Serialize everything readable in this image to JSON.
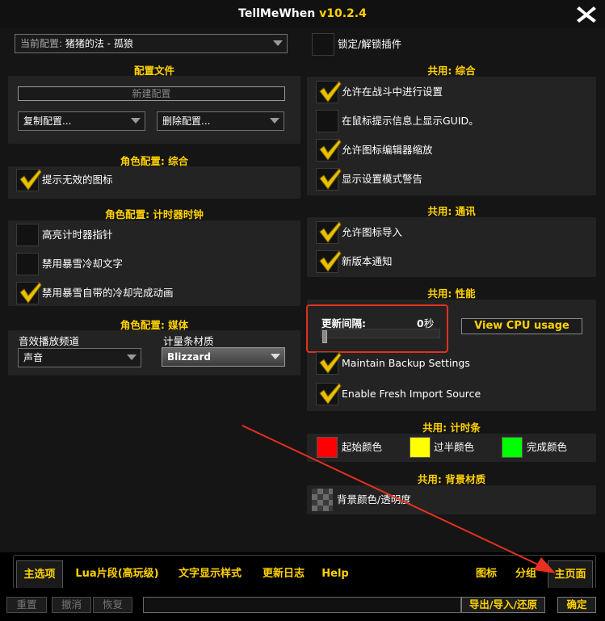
{
  "window": {
    "app_name": "TellMeWhen",
    "version": "v10.2.4",
    "close_glyph": "✕"
  },
  "left": {
    "profile_dropdown": {
      "prefix": "当前配置: ",
      "value": "猪猪的法 - 孤狼"
    },
    "profiles": {
      "title": "配置文件",
      "new_profile_placeholder": "新建配置",
      "copy_dropdown": "复制配置...",
      "delete_dropdown": "删除配置..."
    },
    "char_general": {
      "title": "角色配置: 综合",
      "items": [
        {
          "label": "提示无效的图标",
          "checked": true
        }
      ]
    },
    "char_timer": {
      "title": "角色配置: 计时器时钟",
      "items": [
        {
          "label": "高亮计时器指针",
          "checked": false
        },
        {
          "label": "禁用暴雪冷却文字",
          "checked": false
        },
        {
          "label": "禁用暴雪自带的冷却完成动画",
          "checked": true
        }
      ]
    },
    "char_media": {
      "title": "角色配置: 媒体",
      "sound_channel_label": "音效播放频道",
      "sound_channel_value": "声音",
      "bar_texture_label": "计量条材质",
      "bar_texture_value": "Blizzard"
    }
  },
  "right": {
    "lock_unlock": {
      "label": "锁定/解锁插件",
      "checked": false
    },
    "global_general": {
      "title": "共用: 综合",
      "items": [
        {
          "label": "允许在战斗中进行设置",
          "checked": true
        },
        {
          "label": "在鼠标提示信息上显示GUID。",
          "checked": false
        },
        {
          "label": "允许图标编辑器缩放",
          "checked": true
        },
        {
          "label": "显示设置模式警告",
          "checked": true
        }
      ]
    },
    "global_comm": {
      "title": "共用: 通讯",
      "items": [
        {
          "label": "允许图标导入",
          "checked": true
        },
        {
          "label": "新版本通知",
          "checked": true
        }
      ]
    },
    "global_perf": {
      "title": "共用: 性能",
      "update_interval_label": "更新间隔:",
      "update_interval_value": "0",
      "update_interval_unit": "秒",
      "update_interval_fill": 0,
      "cpu_button": "View CPU usage",
      "items": [
        {
          "label": "Maintain Backup Settings",
          "checked": true
        },
        {
          "label": "Enable Fresh Import Source",
          "checked": true
        }
      ]
    },
    "global_timer_bar": {
      "title": "共用: 计时条",
      "colors": [
        {
          "label": "起始颜色",
          "color": "#ff0000"
        },
        {
          "label": "过半颜色",
          "color": "#ffff00"
        },
        {
          "label": "完成颜色",
          "color": "#00ff00"
        }
      ]
    },
    "global_backdrop": {
      "title": "共用: 背景材质",
      "label": "背景颜色/透明度"
    }
  },
  "tabs": {
    "main": "主选项",
    "lua": "Lua片段(高玩级)",
    "text_style": "文字显示样式",
    "changelog": "更新日志",
    "help": "Help",
    "icon": "图标",
    "group": "分组",
    "main_page": "主页面"
  },
  "bottom": {
    "reset": "重置",
    "undo": "撤消",
    "redo": "恢复",
    "import_export": "导出/导入/还原",
    "ok": "确定"
  },
  "colors": {
    "gold": "#ffd200",
    "highlight_box": "#e03020",
    "arrow": "#e83020"
  }
}
